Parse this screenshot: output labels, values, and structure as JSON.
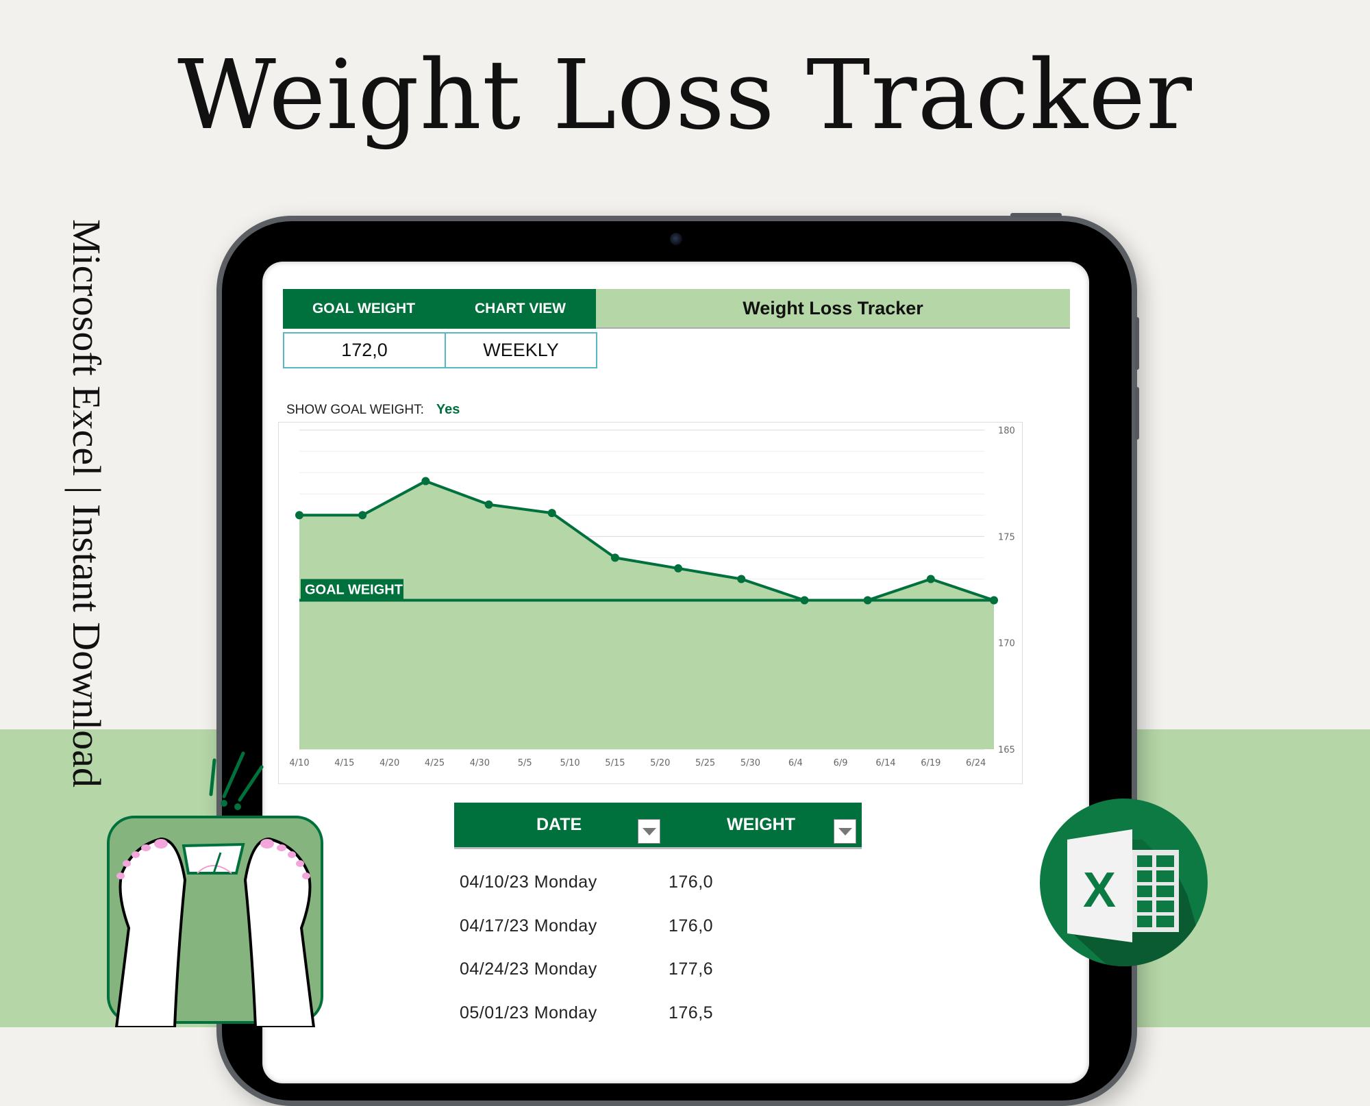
{
  "banner": {
    "title": "Weight Loss Tracker",
    "side_text": "Microsoft Excel | Instant Download"
  },
  "colors": {
    "brand_green": "#00703c",
    "light_green": "#b5d6a7",
    "page_bg": "#f3f1ed",
    "value_border": "#55b9c2"
  },
  "sheet": {
    "header": {
      "goal_weight_label": "GOAL WEIGHT",
      "chart_view_label": "CHART VIEW",
      "title": "Weight Loss Tracker"
    },
    "values": {
      "goal_weight": "172,0",
      "chart_view": "WEEKLY"
    },
    "show_goal": {
      "label": "SHOW GOAL WEIGHT:",
      "value": "Yes"
    },
    "table": {
      "columns": [
        "DATE",
        "WEIGHT"
      ],
      "rows": [
        {
          "date": "04/10/23 Monday",
          "weight": "176,0"
        },
        {
          "date": "04/17/23 Monday",
          "weight": "176,0"
        },
        {
          "date": "04/24/23 Monday",
          "weight": "177,6"
        },
        {
          "date": "05/01/23 Monday",
          "weight": "176,5"
        }
      ]
    }
  },
  "icons": {
    "excel": "excel-logo-icon",
    "scale": "bathroom-scale-illustration",
    "dropdown": "dropdown-arrow-icon"
  },
  "chart_data": {
    "type": "area",
    "title": "",
    "xlabel": "",
    "ylabel": "",
    "x": [
      "4/10",
      "4/17",
      "4/24",
      "5/1",
      "5/8",
      "5/15",
      "5/22",
      "5/29",
      "6/5",
      "6/12",
      "6/19",
      "6/26"
    ],
    "x_day_offsets": [
      0,
      7,
      14,
      21,
      28,
      35,
      42,
      49,
      56,
      63,
      70,
      77
    ],
    "series": [
      {
        "name": "Weight",
        "values": [
          176.0,
          176.0,
          177.6,
          176.5,
          176.1,
          174.0,
          173.5,
          173.0,
          172.0,
          172.0,
          173.0,
          172.0
        ]
      },
      {
        "name": "Goal Weight",
        "values": [
          172.0,
          172.0,
          172.0,
          172.0,
          172.0,
          172.0,
          172.0,
          172.0,
          172.0,
          172.0,
          172.0,
          172.0
        ]
      }
    ],
    "goal_label": "GOAL WEIGHT",
    "x_tick_labels": [
      "4/10",
      "4/15",
      "4/20",
      "4/25",
      "4/30",
      "5/5",
      "5/10",
      "5/15",
      "5/20",
      "5/25",
      "5/30",
      "6/4",
      "6/9",
      "6/14",
      "6/19",
      "6/24"
    ],
    "x_range_days": [
      0,
      77
    ],
    "y_tick_labels": [
      "180",
      "175",
      "170",
      "165"
    ],
    "ylim": [
      165,
      180
    ],
    "y_axis_side": "right",
    "grid": true,
    "legend": "none"
  }
}
